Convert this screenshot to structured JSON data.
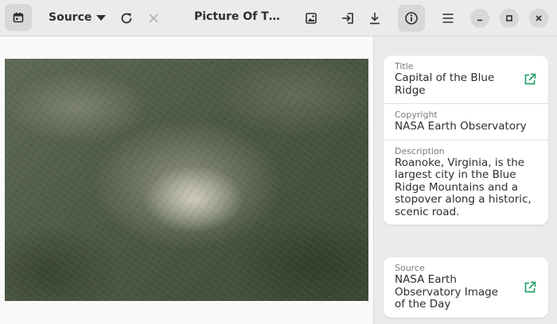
{
  "header": {
    "calendar_icon": "calendar-icon",
    "source_label": "Source",
    "refresh_icon": "refresh-icon",
    "close_icon": "close-x-icon",
    "title": "Picture Of T…",
    "set_wallpaper_icon": "image-icon",
    "import_icon": "import-icon",
    "download_icon": "download-icon",
    "info_icon": "info-icon",
    "menu_icon": "hamburger-menu-icon",
    "window_controls": [
      "minimize",
      "maximize",
      "close"
    ]
  },
  "picture": {
    "subject": "satellite-photo"
  },
  "details": {
    "title_label": "Title",
    "title_value": "Capital of the Blue Ridge",
    "copyright_label": "Copyright",
    "copyright_value": "NASA Earth Observatory",
    "description_label": "Description",
    "description_value": "Roanoke, Virginia, is the largest city in the Blue Ridge Mountains and a stopover along a historic, scenic road."
  },
  "source_card": {
    "label": "Source",
    "value": "NASA Earth Observatory Image of the Day"
  },
  "colors": {
    "accent": "#26a269",
    "header_bg": "#ebebeb",
    "button_bg": "#d8d8d8"
  }
}
